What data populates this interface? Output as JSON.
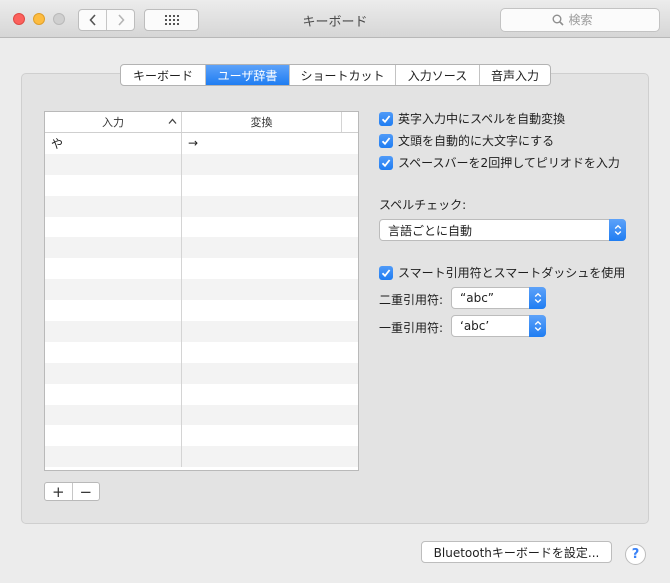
{
  "window": {
    "title": "キーボード"
  },
  "toolbar": {
    "search_placeholder": "検索"
  },
  "tabs": [
    {
      "label": "キーボード",
      "active": false
    },
    {
      "label": "ユーザ辞書",
      "active": true
    },
    {
      "label": "ショートカット",
      "active": false
    },
    {
      "label": "入力ソース",
      "active": false
    },
    {
      "label": "音声入力",
      "active": false
    }
  ],
  "dictionary": {
    "columns": {
      "input": "入力",
      "conversion": "変換"
    },
    "rows": [
      {
        "input": "や",
        "conversion": "→"
      },
      {
        "input": "",
        "conversion": ""
      },
      {
        "input": "",
        "conversion": ""
      },
      {
        "input": "",
        "conversion": ""
      },
      {
        "input": "",
        "conversion": ""
      },
      {
        "input": "",
        "conversion": ""
      },
      {
        "input": "",
        "conversion": ""
      },
      {
        "input": "",
        "conversion": ""
      },
      {
        "input": "",
        "conversion": ""
      },
      {
        "input": "",
        "conversion": ""
      },
      {
        "input": "",
        "conversion": ""
      },
      {
        "input": "",
        "conversion": ""
      },
      {
        "input": "",
        "conversion": ""
      },
      {
        "input": "",
        "conversion": ""
      },
      {
        "input": "",
        "conversion": ""
      },
      {
        "input": "",
        "conversion": ""
      }
    ],
    "add_label": "+",
    "remove_label": "−"
  },
  "options": {
    "autocorrect": {
      "label": "英字入力中にスペルを自動変換",
      "checked": true
    },
    "capitalize": {
      "label": "文頭を自動的に大文字にする",
      "checked": true
    },
    "period": {
      "label": "スペースバーを2回押してピリオドを入力",
      "checked": true
    },
    "spell_label": "スペルチェック:",
    "spell_value": "言語ごとに自動",
    "smart_quotes": {
      "label": "スマート引用符とスマートダッシュを使用",
      "checked": true
    },
    "double_label": "二重引用符:",
    "double_value": "“abc”",
    "single_label": "一重引用符:",
    "single_value": "‘abc’"
  },
  "footer": {
    "bluetooth_label": "Bluetoothキーボードを設定...",
    "help_label": "?"
  },
  "colors": {
    "accent": "#1f7df2"
  }
}
